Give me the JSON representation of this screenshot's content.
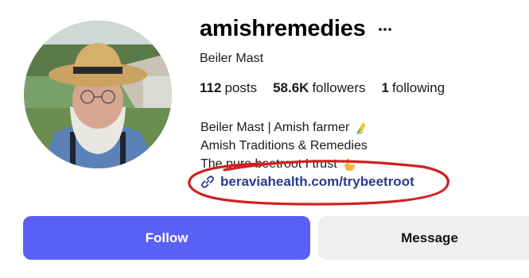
{
  "profile": {
    "username": "amishremedies",
    "full_name": "Beiler Mast",
    "stats": {
      "posts_count": "112",
      "posts_label": "posts",
      "followers_count": "58.6K",
      "followers_label": "followers",
      "following_count": "1",
      "following_label": "following"
    },
    "bio": {
      "line1": "Beiler Mast | Amish farmer",
      "line2": "Amish Traditions & Remedies",
      "line3": "The pure beetroot I trust",
      "link": "beraviahealth.com/trybeetroot"
    },
    "annotation_color": "#d11f1f"
  },
  "actions": {
    "follow_label": "Follow",
    "message_label": "Message"
  },
  "colors": {
    "follow_bg": "#5a5ff5",
    "message_bg": "#efefef",
    "link": "#2b3a8c"
  },
  "icons": {
    "more": "more-horizontal-icon",
    "link": "link-icon",
    "corn": "corn-emoji-icon",
    "pointing": "point-down-emoji-icon"
  }
}
